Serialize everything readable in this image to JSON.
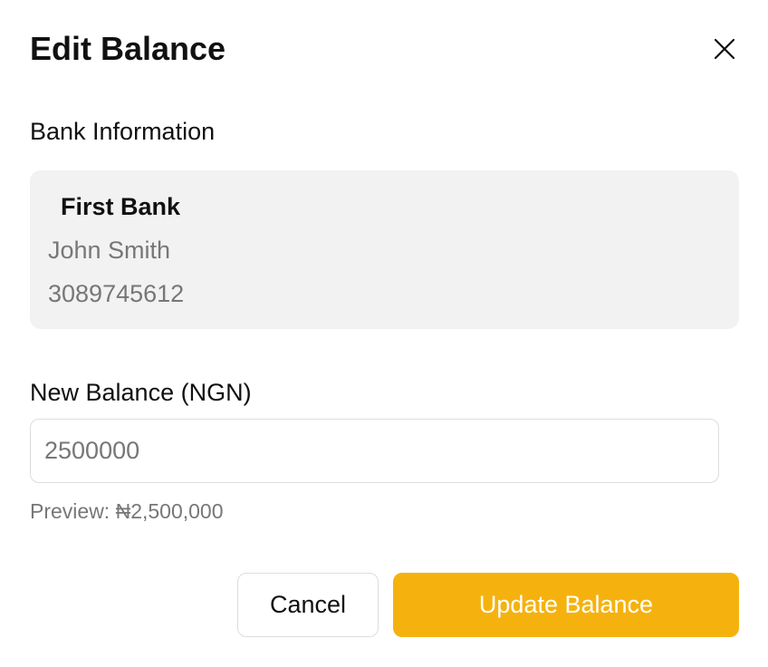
{
  "dialog": {
    "title": "Edit Balance",
    "close_icon": "close-icon"
  },
  "bank_info": {
    "label": "Bank Information",
    "bank_name": "First Bank",
    "account_name": "John Smith",
    "account_number": "3089745612"
  },
  "balance": {
    "label": "New Balance (NGN)",
    "value": "2500000",
    "preview": "Preview: ₦2,500,000"
  },
  "actions": {
    "cancel_label": "Cancel",
    "update_label": "Update Balance"
  },
  "colors": {
    "accent": "#f5b20f",
    "card_bg": "#f2f2f2",
    "muted_text": "#777777"
  }
}
